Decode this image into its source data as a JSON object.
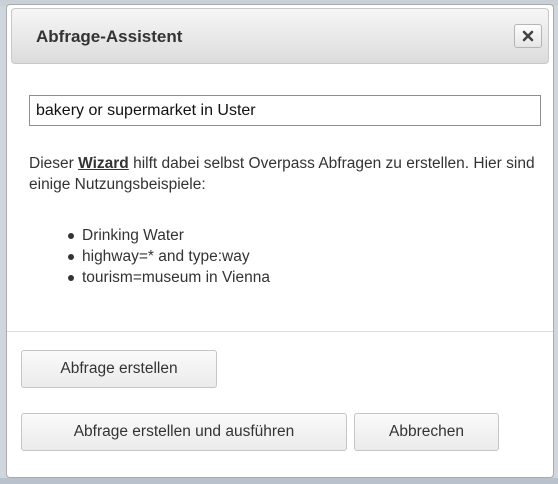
{
  "dialog": {
    "title": "Abfrage-Assistent",
    "close_icon": "close-icon"
  },
  "query": {
    "value": "bakery or supermarket in Uster"
  },
  "intro": {
    "prefix": "Dieser ",
    "link": "Wizard",
    "suffix": " hilft dabei selbst Overpass Abfragen zu erstellen. Hier sind einige Nutzungsbeispiele:"
  },
  "examples": [
    "Drinking Water",
    "highway=* and type:way",
    "tourism=museum in Vienna"
  ],
  "buttons": {
    "create": "Abfrage erstellen",
    "create_run": "Abfrage erstellen und ausführen",
    "cancel": "Abbrechen"
  }
}
